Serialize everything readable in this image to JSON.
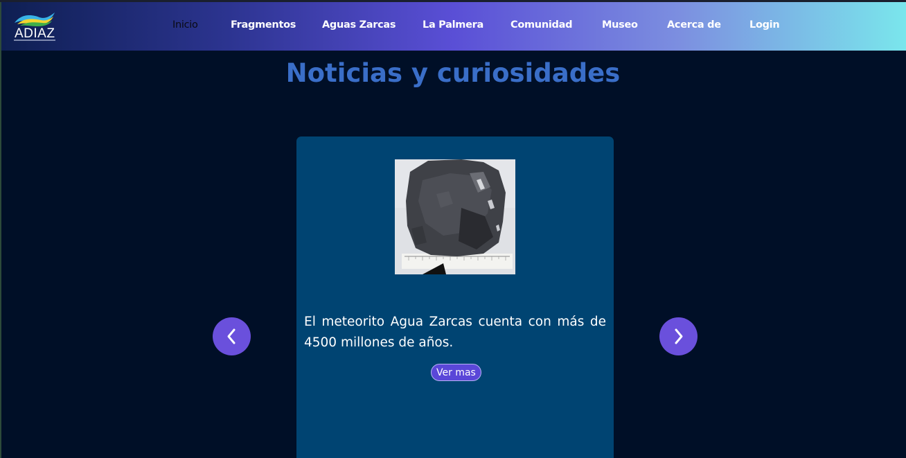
{
  "brand": {
    "logo_text": "ADIAZ"
  },
  "nav": {
    "items": [
      {
        "label": "Inicio",
        "active": true
      },
      {
        "label": "Fragmentos"
      },
      {
        "label": "Aguas Zarcas"
      },
      {
        "label": "La Palmera"
      },
      {
        "label": "Comunidad"
      },
      {
        "label": "Museo"
      },
      {
        "label": "Acerca de"
      },
      {
        "label": "Login"
      }
    ]
  },
  "page": {
    "title": "Noticias y curiosidades"
  },
  "carousel": {
    "prev_icon": "chevron-left-icon",
    "next_icon": "chevron-right-icon",
    "card": {
      "image": "meteorite-photo",
      "text": "El meteorito Agua Zarcas cuenta con más de 4500 millones de años.",
      "button_label": "Ver mas"
    }
  },
  "colors": {
    "background": "#000f27",
    "title": "#3a6ec8",
    "card": "#004472",
    "accent": "#6a50dc",
    "nav_gradient_start": "#0e1f52",
    "nav_gradient_end": "#7ae6ec"
  }
}
